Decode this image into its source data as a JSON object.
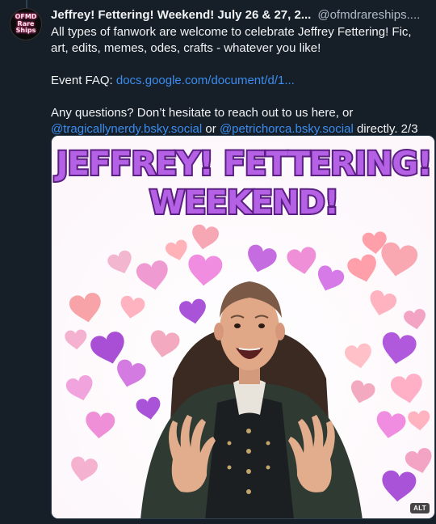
{
  "avatar": {
    "lines": [
      "OFMD",
      "Rare",
      "Ships"
    ]
  },
  "post": {
    "display_name": "Jeffrey! Fettering! Weekend! July 26 & 27, 2...",
    "handle": "@ofmdrareships....",
    "line1": "All types of fanwork are welcome to celebrate Jeffrey Fettering! Fic, art, edits, memes, odes, crafts - whatever you like!",
    "faq_label": "Event FAQ: ",
    "faq_link": "docs.google.com/document/d/1...",
    "questions": "Any questions? Don’t hesitate to reach out to us here, or",
    "mention1": "@tragicallynerdy.bsky.social",
    "or_text": " or ",
    "mention2": "@petrichorca.bsky.social",
    "tail_text": " directly. 2/3"
  },
  "image": {
    "title_line1": "JEFFREY! FETTERING!",
    "title_line2": "WEEKEND!",
    "alt_badge": "ALT"
  },
  "colors": {
    "background": "#161e27",
    "link": "#3b8df0",
    "title_fill": "#b561e6",
    "title_stroke": "#5a1f80"
  }
}
